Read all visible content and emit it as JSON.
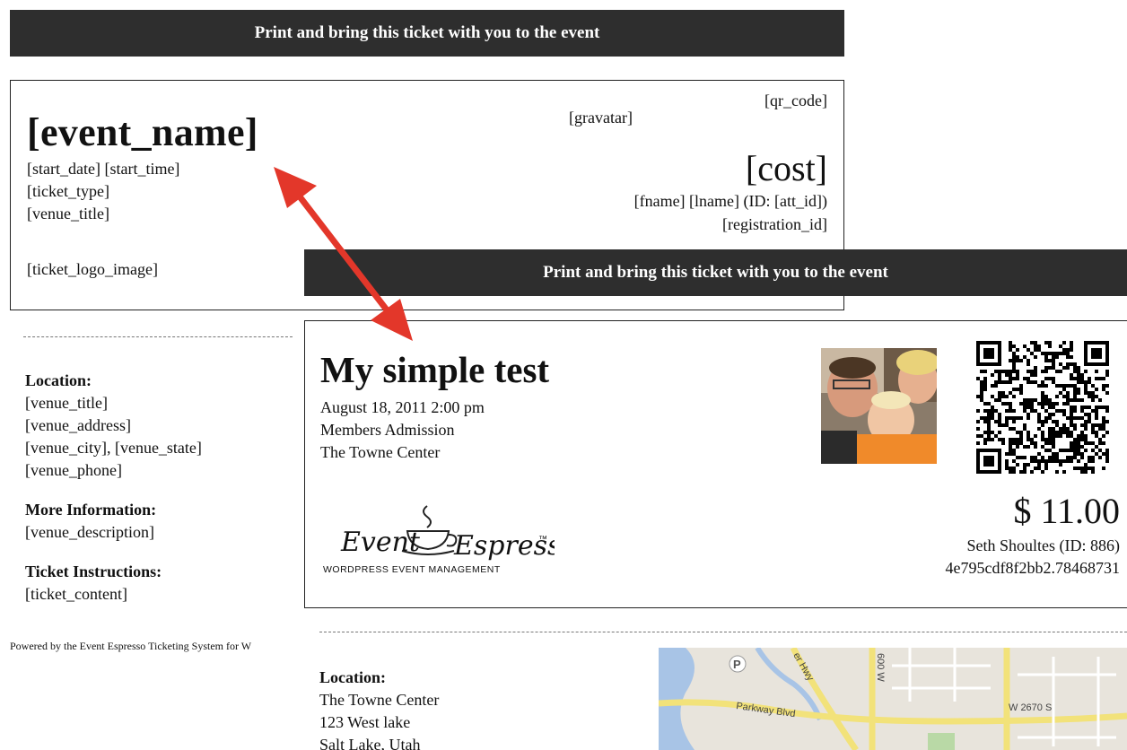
{
  "template": {
    "banner": "Print and bring this ticket with you to the event",
    "event_name": "[event_name]",
    "lines": [
      "[start_date] [start_time]",
      "[ticket_type]",
      "[venue_title]"
    ],
    "logo": "[ticket_logo_image]",
    "qr": "[qr_code]",
    "gravatar": "[gravatar]",
    "cost": "[cost]",
    "attendee": "[fname] [lname] (ID: [att_id])",
    "registration": "[registration_id]",
    "info": {
      "location_heading": "Location:",
      "location_lines": [
        "[venue_title]",
        "[venue_address]",
        "[venue_city], [venue_state]",
        "[venue_phone]"
      ],
      "more_heading": "More Information:",
      "more_lines": [
        "[venue_description]"
      ],
      "instructions_heading": "Ticket Instructions:",
      "instructions_lines": [
        "[ticket_content]"
      ]
    },
    "footer": "Powered by the Event Espresso Ticketing System for W"
  },
  "sample": {
    "banner": "Print and bring this ticket with you to the event",
    "event_name": "My simple test",
    "lines": [
      "August 18, 2011 2:00 pm",
      "Members Admission",
      "The Towne Center"
    ],
    "logo": {
      "text_left": "Event",
      "text_right": "Espresso",
      "tm": "™",
      "tagline": "WORDPRESS EVENT MANAGEMENT"
    },
    "cost": "$ 11.00",
    "attendee": "Seth Shoultes (ID: 886)",
    "registration": "4e795cdf8f2bb2.78468731",
    "location_heading": "Location:",
    "location_lines": [
      "The Towne Center",
      "123 West lake",
      "Salt Lake, Utah"
    ],
    "map": {
      "labels": [
        "P",
        "er Hwy",
        "600 W",
        "Parkway Blvd",
        "W 2670 S"
      ]
    }
  },
  "colors": {
    "banner_bg": "#2e2e2e",
    "arrow": "#e3372a",
    "map_bg": "#e8e4dc",
    "map_road": "#f2e27a",
    "map_water": "#a8c4e6"
  },
  "icons": [
    "double-arrow-icon",
    "qr-code-icon",
    "gravatar-photo",
    "coffee-cup-logo",
    "map-thumbnail"
  ]
}
